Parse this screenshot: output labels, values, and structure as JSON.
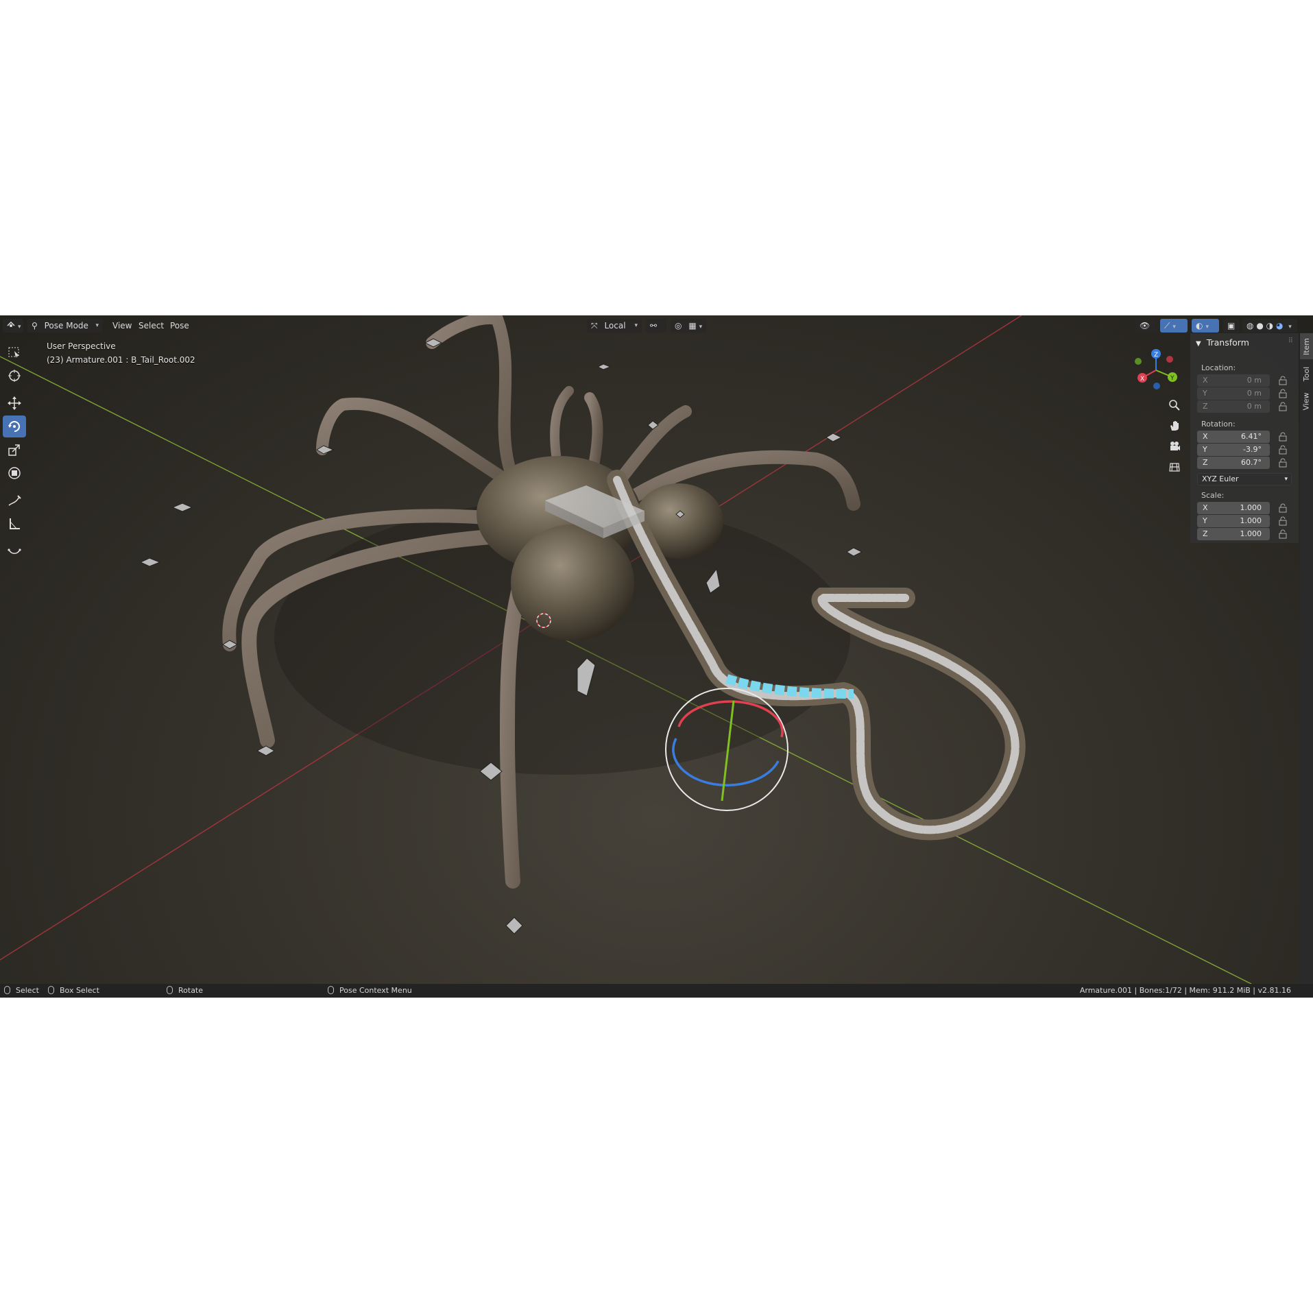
{
  "header": {
    "mode_label": "Pose Mode",
    "menus": [
      "View",
      "Select",
      "Pose"
    ],
    "orientation_label": "Local"
  },
  "viewport": {
    "view_name": "User Perspective",
    "active_info": "(23) Armature.001 : B_Tail_Root.002"
  },
  "toolbar": {
    "tools": [
      "select-box",
      "cursor",
      "move",
      "rotate",
      "scale",
      "transform",
      "annotate",
      "measure",
      "relax"
    ],
    "active_tool": "rotate"
  },
  "gizmo": {
    "axes": [
      "X",
      "Y",
      "Z"
    ]
  },
  "npanel": {
    "title": "Transform",
    "location": {
      "label": "Location:",
      "x": "0 m",
      "y": "0 m",
      "z": "0 m"
    },
    "rotation": {
      "label": "Rotation:",
      "x": "6.41°",
      "y": "-3.9°",
      "z": "60.7°"
    },
    "rotation_mode": "XYZ Euler",
    "scale": {
      "label": "Scale:",
      "x": "1.000",
      "y": "1.000",
      "z": "1.000"
    },
    "tabs": [
      "Item",
      "Tool",
      "View"
    ],
    "active_tab": "Item"
  },
  "statusbar": {
    "select": "Select",
    "box_select": "Box Select",
    "rotate": "Rotate",
    "context_menu": "Pose Context Menu",
    "stats": "Armature.001 | Bones:1/72 | Mem: 911.2 MiB | v2.81.16"
  },
  "colors": {
    "accent": "#4772b3",
    "axis_x": "#e04050",
    "axis_y": "#80c020",
    "axis_z": "#3a7de0",
    "selected_bone": "#7ad7ee"
  }
}
